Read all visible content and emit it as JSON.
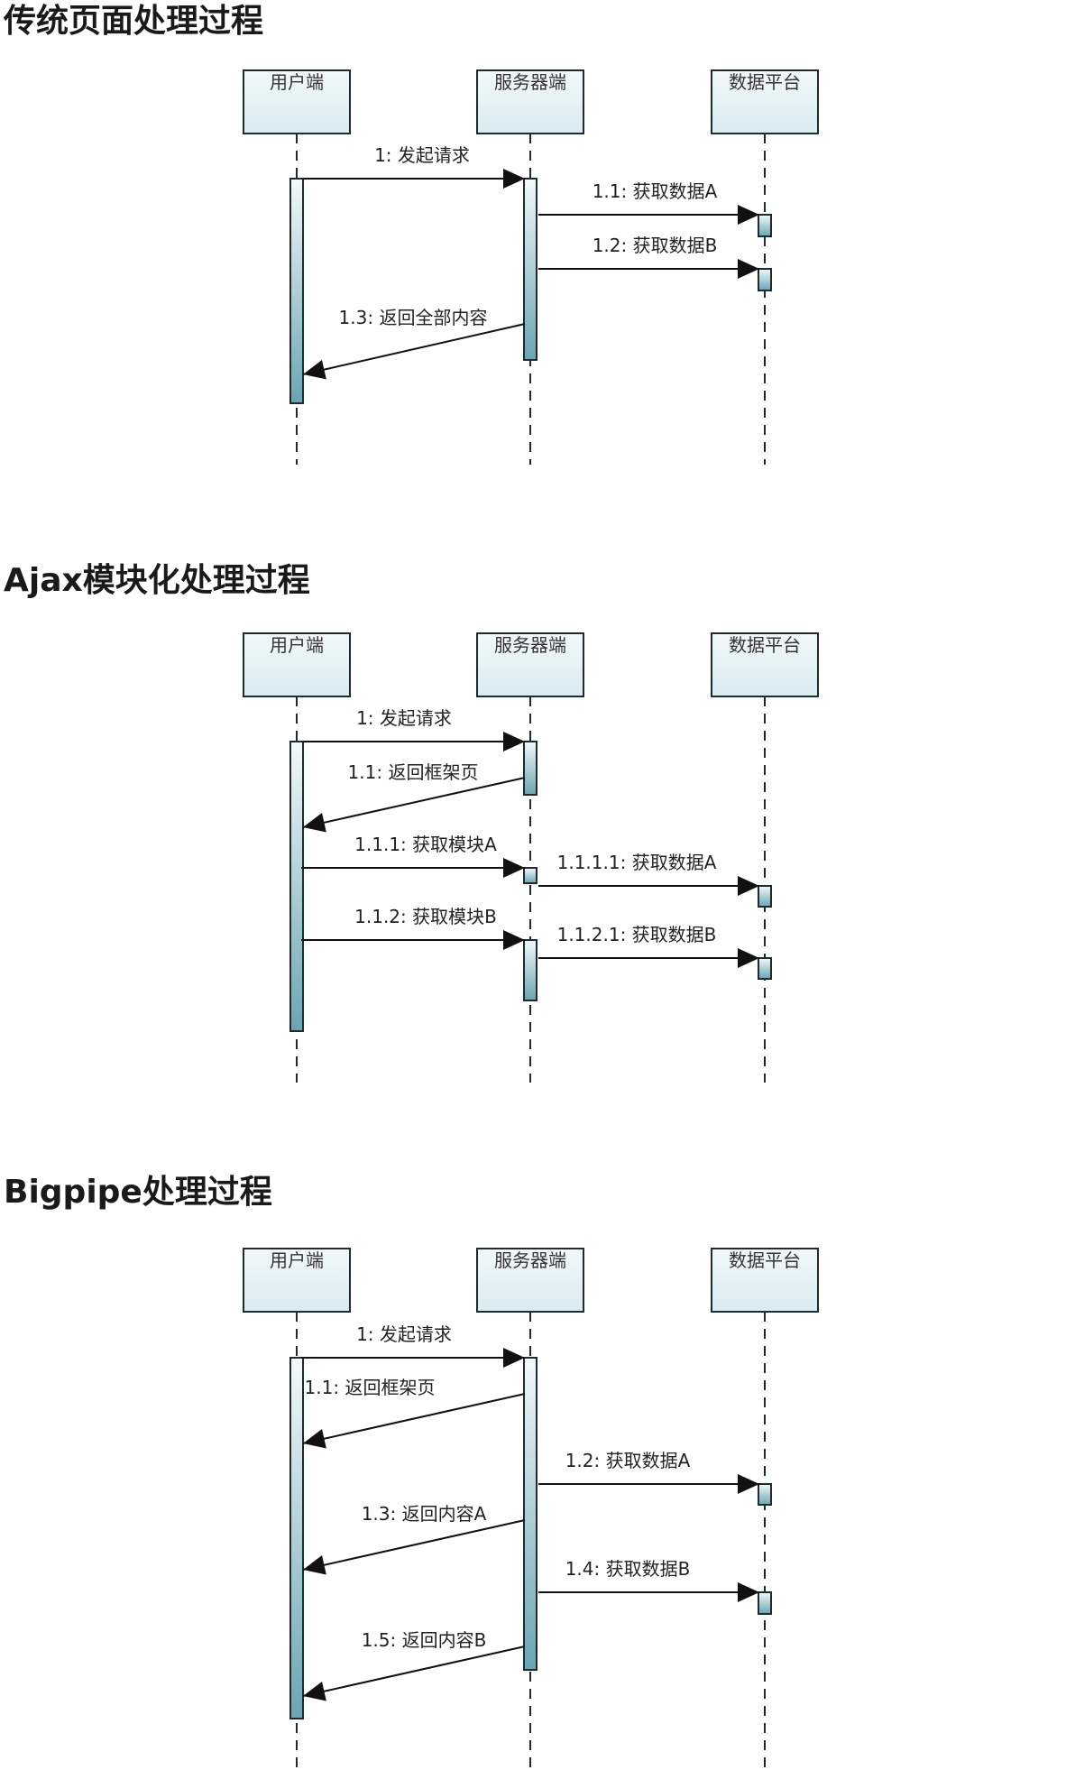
{
  "participants": [
    "用户端",
    "服务器端",
    "数据平台"
  ],
  "diagrams": [
    {
      "title": "传统页面处理过程",
      "messages": [
        {
          "label": "1: 发起请求"
        },
        {
          "label": "1.1: 获取数据A"
        },
        {
          "label": "1.2: 获取数据B"
        },
        {
          "label": "1.3: 返回全部内容"
        }
      ]
    },
    {
      "title": "Ajax模块化处理过程",
      "messages": [
        {
          "label": "1: 发起请求"
        },
        {
          "label": "1.1: 返回框架页"
        },
        {
          "label": "1.1.1: 获取模块A"
        },
        {
          "label": "1.1.1.1: 获取数据A"
        },
        {
          "label": "1.1.2: 获取模块B"
        },
        {
          "label": "1.1.2.1: 获取数据B"
        }
      ]
    },
    {
      "title": "Bigpipe处理过程",
      "messages": [
        {
          "label": "1: 发起请求"
        },
        {
          "label": "1.1: 返回框架页"
        },
        {
          "label": "1.2: 获取数据A"
        },
        {
          "label": "1.3: 返回内容A"
        },
        {
          "label": "1.4: 获取数据B"
        },
        {
          "label": "1.5: 返回内容B"
        }
      ]
    }
  ],
  "colors": {
    "header_fill_top": "#f2f8fa",
    "header_fill_bottom": "#d8ebf1",
    "activation_top": "#f4f9fb",
    "activation_bottom": "#6aa5b3",
    "stroke": "#1e2a2e"
  }
}
